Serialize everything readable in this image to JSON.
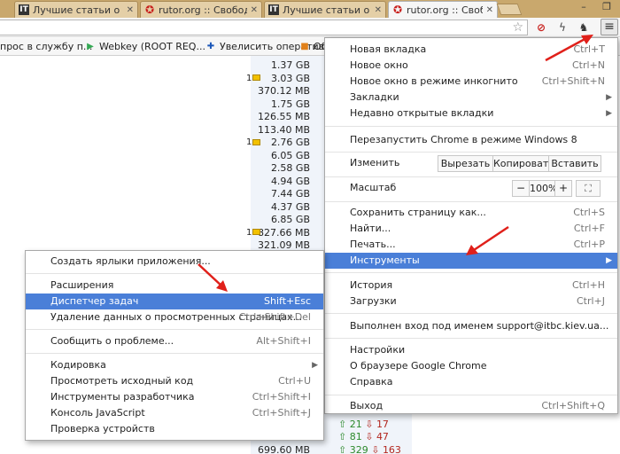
{
  "tabs": [
    {
      "icon": "IT",
      "label": "Лучшие статьи о опер"
    },
    {
      "icon": "rutor",
      "label": "rutor.org :: Свободный"
    },
    {
      "icon": "IT",
      "label": "Лучшие статьи о опер"
    },
    {
      "icon": "rutor",
      "label": "rutor.org :: Свободный",
      "active": true
    }
  ],
  "window_controls": {
    "minimize": "–",
    "maximize": "❐"
  },
  "bookmarks": [
    {
      "label": "прос в службу п..."
    },
    {
      "label": "Webkey (ROOT REQ..."
    },
    {
      "label": "Увелисить оперативу"
    },
    {
      "label": "Об"
    }
  ],
  "content": {
    "sizes": [
      "1.37 GB",
      "3.03 GB",
      "370.12 MB",
      "1.75 GB",
      "126.55 MB",
      "113.40 MB",
      "2.76 GB",
      "6.05 GB",
      "2.58 GB",
      "4.94 GB",
      "7.44 GB",
      "4.37 GB",
      "6.85 GB",
      "827.66 MB",
      "321.09 MB"
    ],
    "comments": [
      {
        "row": 1,
        "count": "1"
      },
      {
        "row": 6,
        "count": "1"
      },
      {
        "row": 13,
        "count": "1"
      }
    ],
    "bottom_size": "699.60 MB",
    "peers": [
      {
        "up": "21",
        "down": "17"
      },
      {
        "up": "81",
        "down": "47"
      },
      {
        "up": "329",
        "down": "163"
      }
    ]
  },
  "main_menu": {
    "new_tab": {
      "label": "Новая вкладка",
      "shortcut": "Ctrl+T"
    },
    "new_window": {
      "label": "Новое окно",
      "shortcut": "Ctrl+N"
    },
    "incognito": {
      "label": "Новое окно в режиме инкогнито",
      "shortcut": "Ctrl+Shift+N"
    },
    "bookmarks": {
      "label": "Закладки"
    },
    "recent_tabs": {
      "label": "Недавно открытые вкладки"
    },
    "relaunch": {
      "label": "Перезапустить Chrome в режиме Windows 8"
    },
    "edit": {
      "label": "Изменить",
      "cut": "Вырезать",
      "copy": "Копировать",
      "paste": "Вставить"
    },
    "zoom": {
      "label": "Масштаб",
      "minus": "−",
      "value": "100%",
      "plus": "+"
    },
    "save_page": {
      "label": "Сохранить страницу как...",
      "shortcut": "Ctrl+S"
    },
    "find": {
      "label": "Найти...",
      "shortcut": "Ctrl+F"
    },
    "print": {
      "label": "Печать...",
      "shortcut": "Ctrl+P"
    },
    "tools": {
      "label": "Инструменты"
    },
    "history": {
      "label": "История",
      "shortcut": "Ctrl+H"
    },
    "downloads": {
      "label": "Загрузки",
      "shortcut": "Ctrl+J"
    },
    "signed_in": {
      "label": "Выполнен вход под именем support@itbc.kiev.ua..."
    },
    "settings": {
      "label": "Настройки"
    },
    "about": {
      "label": "О браузере Google Chrome"
    },
    "help": {
      "label": "Справка"
    },
    "exit": {
      "label": "Выход",
      "shortcut": "Ctrl+Shift+Q"
    }
  },
  "tools_submenu": {
    "create_shortcuts": {
      "label": "Создать ярлыки приложения..."
    },
    "extensions": {
      "label": "Расширения"
    },
    "task_manager": {
      "label": "Диспетчер задач",
      "shortcut": "Shift+Esc"
    },
    "clear_data": {
      "label": "Удаление данных о просмотренных страницах...",
      "shortcut": "Ctrl+Shift+Del"
    },
    "report_issue": {
      "label": "Сообщить о проблеме...",
      "shortcut": "Alt+Shift+I"
    },
    "encoding": {
      "label": "Кодировка"
    },
    "view_source": {
      "label": "Просмотреть исходный код",
      "shortcut": "Ctrl+U"
    },
    "dev_tools": {
      "label": "Инструменты разработчика",
      "shortcut": "Ctrl+Shift+I"
    },
    "js_console": {
      "label": "Консоль JavaScript",
      "shortcut": "Ctrl+Shift+J"
    },
    "inspect_devices": {
      "label": "Проверка устройств"
    }
  },
  "colors": {
    "highlight": "#4a7fd8",
    "annotation": "#e0201a",
    "tabstrip": "#c9a86d"
  }
}
